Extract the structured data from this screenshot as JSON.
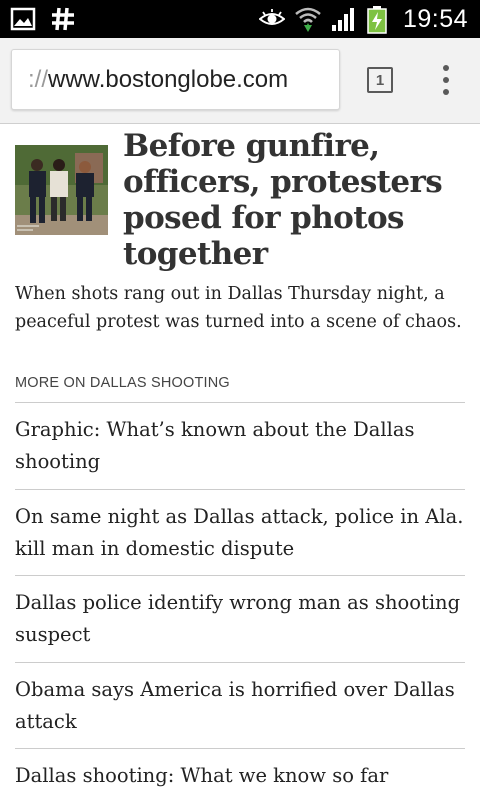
{
  "status_bar": {
    "time": "19:54",
    "left_icons": [
      "image-icon",
      "hashtag-icon"
    ],
    "right_icons": [
      "eye-icon",
      "wifi-icon",
      "signal-icon",
      "battery-charging-icon"
    ]
  },
  "browser": {
    "url_scheme": "://",
    "url_host": "www.bostonglobe.com",
    "tab_count": "1",
    "menu_icon": "overflow-menu-icon"
  },
  "article": {
    "thumbnail_icon": "news-photo",
    "title": "Before gunfire, officers, protesters posed for photos together",
    "summary": "When shots rang out in Dallas Thursday night, a peaceful protest was turned into a scene of chaos."
  },
  "related": {
    "label": "MORE ON DALLAS SHOOTING",
    "items": [
      "Graphic: What’s known about the Dallas shooting",
      "On same night as Dallas attack, police in Ala. kill man in domestic dispute",
      "Dallas police identify wrong man as shooting suspect",
      "Obama says America is horrified over Dallas attack",
      "Dallas shooting: What we know so far"
    ]
  }
}
